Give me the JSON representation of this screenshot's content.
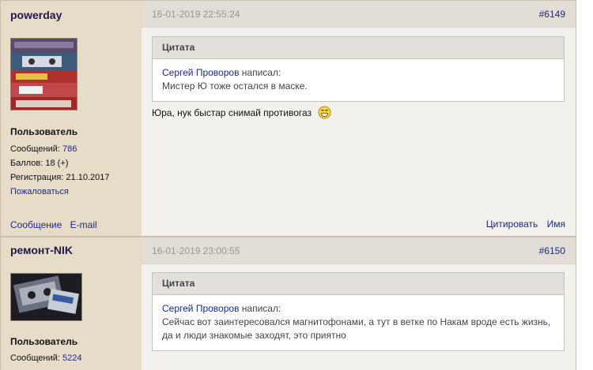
{
  "posts": [
    {
      "username": "powerday",
      "role": "Пользователь",
      "messages_label": "Сообщений:",
      "messages_value": "786",
      "points_label": "Баллов:",
      "points_value": "18 (+)",
      "reg_label": "Регистрация:",
      "reg_value": "21.10.2017",
      "complain": "Пожаловаться",
      "msg_link": "Сообщение",
      "email_link": "E-mail",
      "date": "16-01-2019 22:55:24",
      "number": "#6149",
      "quote_title": "Цитата",
      "quote_author": "Сергей Проворов",
      "quote_wrote": "написал:",
      "quote_lines": [
        "Мистер Ю тоже остался в маске."
      ],
      "text": "Юра, нук быстар снимай противогаз",
      "quote_action": "Цитировать",
      "name_action": "Имя"
    },
    {
      "username": "ремонт-NIK",
      "role": "Пользователь",
      "messages_label": "Сообщений:",
      "messages_value": "5224",
      "date": "16-01-2019 23:00:55",
      "number": "#6150",
      "quote_title": "Цитата",
      "quote_author": "Сергей Проворов",
      "quote_wrote": "написал:",
      "quote_lines": [
        "Сейчас вот заинтересовался магнитофонами, а тут в ветке по Накам вроде есть жизнь,",
        "да и люди знакомые заходят, это приятно"
      ]
    }
  ],
  "colors": {
    "sidebar": "#e6dcc8",
    "content": "#f3f1ee",
    "link": "#1b2a87",
    "header": "#e2ddd6"
  }
}
